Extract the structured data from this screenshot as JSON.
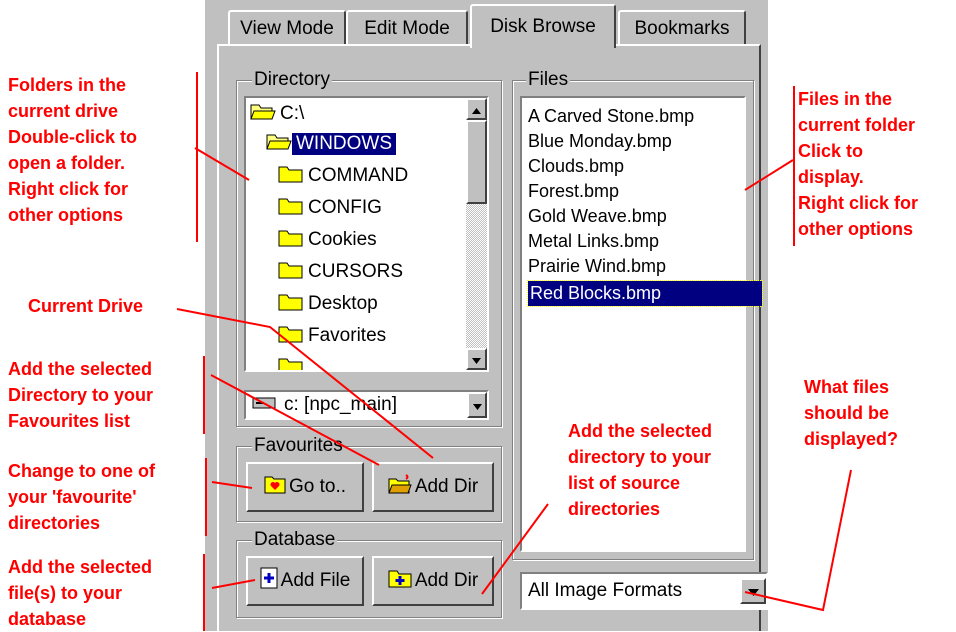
{
  "tabs": [
    {
      "label": "View Mode"
    },
    {
      "label": "Edit Mode"
    },
    {
      "label": "Disk Browse"
    },
    {
      "label": "Bookmarks"
    }
  ],
  "directory": {
    "legend": "Directory",
    "items": [
      "C:\\",
      "WINDOWS",
      "COMMAND",
      "CONFIG",
      "Cookies",
      "CURSORS",
      "Desktop",
      "Favorites"
    ],
    "selected": "WINDOWS"
  },
  "drive": {
    "value": "c: [npc_main]"
  },
  "favourites": {
    "legend": "Favourites",
    "goto_label": "Go to..",
    "add_dir_label": "Add Dir"
  },
  "database": {
    "legend": "Database",
    "add_file_label": "Add File",
    "add_dir_label": "Add Dir"
  },
  "files": {
    "legend": "Files",
    "items": [
      "A Carved Stone.bmp",
      "Blue Monday.bmp",
      "Clouds.bmp",
      "Forest.bmp",
      "Gold Weave.bmp",
      "Metal Links.bmp",
      "Prairie Wind.bmp",
      "Red Blocks.bmp"
    ],
    "selected": "Red Blocks.bmp"
  },
  "filter": {
    "value": "All Image Formats"
  },
  "annotations": {
    "folders": "Folders in the\ncurrent drive\nDouble-click to\nopen a folder.\nRight click for\nother options",
    "current_drive": "Current Drive",
    "add_fav": "Add the selected\nDirectory to your\nFavourites list",
    "change_fav": "Change to one of\nyour 'favourite'\ndirectories",
    "add_file": "Add the selected\nfile(s) to your\ndatabase",
    "files_info": "Files in the\ncurrent folder\nClick to\ndisplay.\nRight click for\nother options",
    "add_source": "Add the selected\ndirectory to your\nlist of source\ndirectories",
    "what_files": "What files\nshould be\ndisplayed?"
  },
  "colors": {
    "annotation": "#ff0000",
    "selection": "#000080",
    "face": "#c0c0c0"
  }
}
